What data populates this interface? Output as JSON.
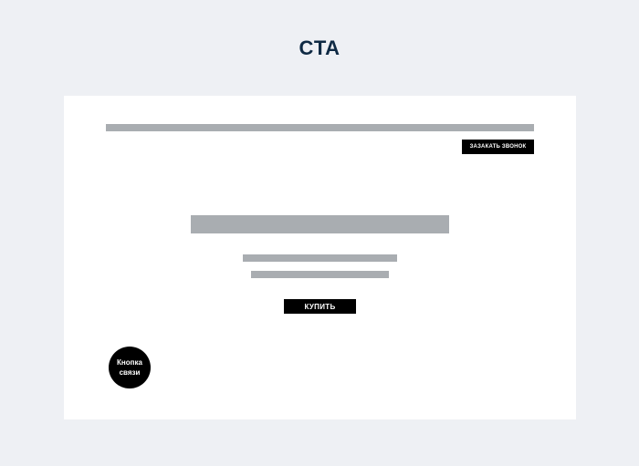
{
  "page": {
    "title": "CTA"
  },
  "header": {
    "callback_label": "ЗАЗАКАТЬ ЗВОНОК"
  },
  "hero": {
    "buy_label": "КУПИТЬ"
  },
  "contact": {
    "label_line1": "Кнопка",
    "label_line2": "связи"
  },
  "colors": {
    "background": "#eef0f4",
    "canvas": "#ffffff",
    "placeholder": "#a9adb1",
    "button": "#000000",
    "title": "#0f2a44"
  }
}
